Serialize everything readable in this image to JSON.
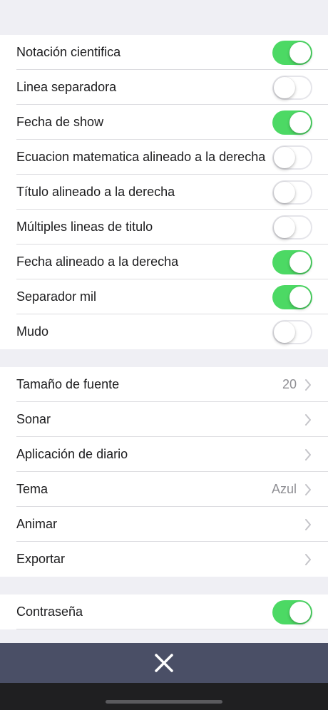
{
  "toggles": [
    {
      "label": "Notación cientifica",
      "on": true
    },
    {
      "label": "Linea separadora",
      "on": false
    },
    {
      "label": "Fecha de show",
      "on": true
    },
    {
      "label": "Ecuacion matematica alineado a la derecha",
      "on": false
    },
    {
      "label": "Título alineado a la derecha",
      "on": false
    },
    {
      "label": "Múltiples lineas de titulo",
      "on": false
    },
    {
      "label": "Fecha alineado a la derecha",
      "on": true
    },
    {
      "label": "Separador mil",
      "on": true
    },
    {
      "label": "Mudo",
      "on": false
    }
  ],
  "options": [
    {
      "label": "Tamaño de fuente",
      "value": "20"
    },
    {
      "label": "Sonar",
      "value": ""
    },
    {
      "label": "Aplicación de diario",
      "value": ""
    },
    {
      "label": "Tema",
      "value": "Azul"
    },
    {
      "label": "Animar",
      "value": ""
    },
    {
      "label": "Exportar",
      "value": ""
    }
  ],
  "password": {
    "label": "Contraseña",
    "on": true
  },
  "icons": {
    "close": "close-icon",
    "chevron": "chevron-right-icon"
  },
  "colors": {
    "toggle_on": "#4cd964",
    "bottom_bar": "#4a4f66",
    "background": "#efeff4"
  }
}
